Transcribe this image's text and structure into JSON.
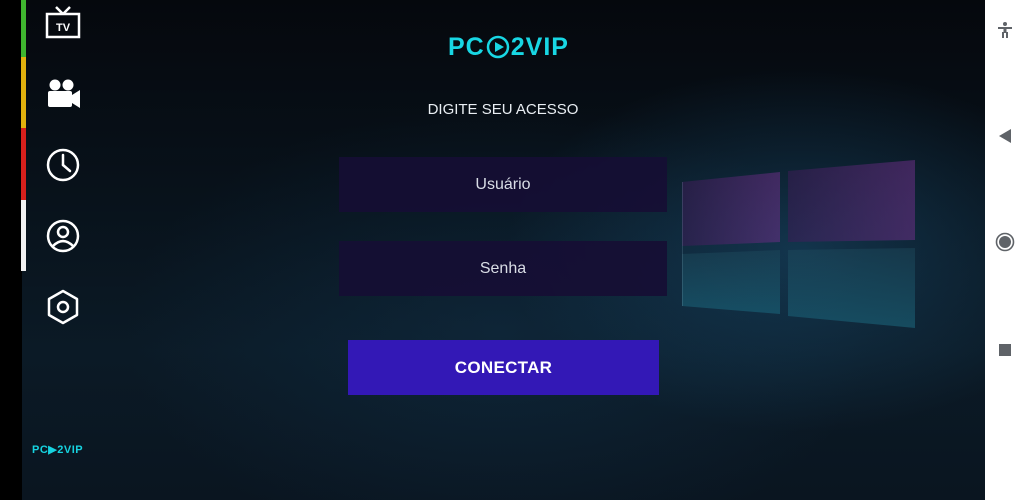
{
  "sidebar": {
    "items": [
      {
        "icon": "tv-icon",
        "label": "TV"
      },
      {
        "icon": "video-camera-icon"
      },
      {
        "icon": "clock-icon"
      },
      {
        "icon": "user-icon"
      },
      {
        "icon": "settings-hexagon-icon"
      }
    ],
    "logo": "PC▶2VIP"
  },
  "header": {
    "logo_prefix": "PC",
    "logo_suffix": "2VIP",
    "prompt": "DIGITE SEU ACESSO"
  },
  "form": {
    "user_placeholder": "Usuário",
    "pass_placeholder": "Senha",
    "connect_label": "CONECTAR"
  },
  "colors": {
    "accent": "#3318b6",
    "logo": "#18d7e4",
    "field_bg": "#160e34",
    "bar_green": "#3fb62f",
    "bar_yellow": "#e2b10d",
    "bar_red": "#d8201c",
    "bar_white": "#f2f2f2"
  },
  "navbar": {
    "items": [
      "accessibility-icon",
      "back-icon",
      "home-icon",
      "recents-icon"
    ]
  }
}
